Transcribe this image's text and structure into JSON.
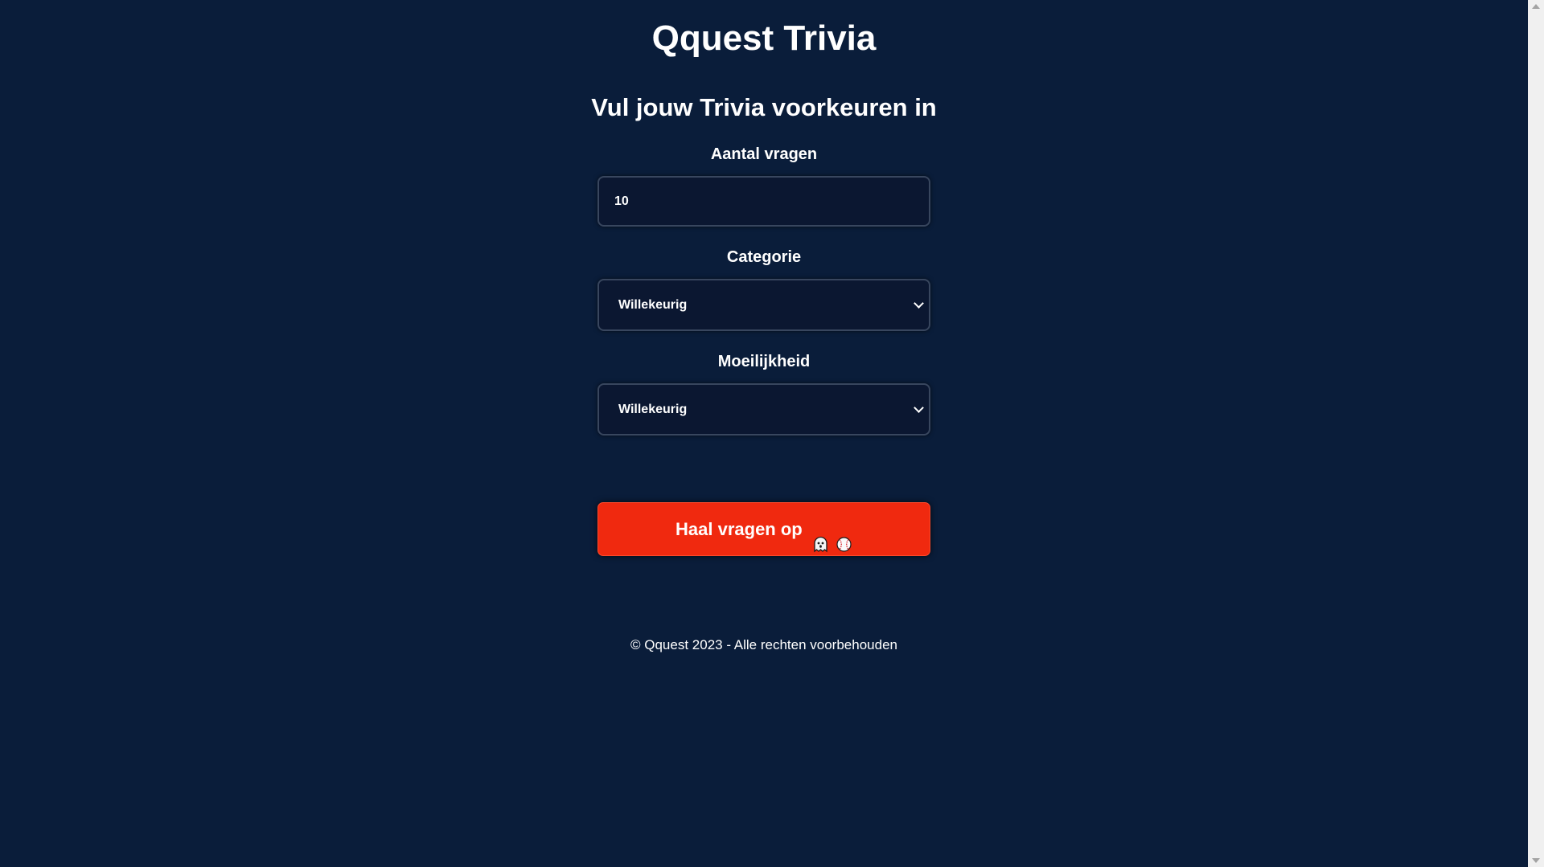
{
  "app": {
    "title": "Qquest Trivia",
    "subtitle": "Vul jouw Trivia voorkeuren in"
  },
  "form": {
    "count": {
      "label": "Aantal vragen",
      "value": "10"
    },
    "category": {
      "label": "Categorie",
      "selected": "Willekeurig"
    },
    "difficulty": {
      "label": "Moeilijkheid",
      "selected": "Willekeurig"
    },
    "submit": {
      "label": "Haal vragen op",
      "icons": [
        "ghost-emoji-icon",
        "baseball-emoji-icon"
      ]
    }
  },
  "footer": {
    "text": "© Qquest 2023 - Alle rechten voorbehouden"
  },
  "colors": {
    "background": "#0a1d3a",
    "field_background": "#0b1731",
    "button": "#f0290f",
    "text": "#ffffff"
  }
}
